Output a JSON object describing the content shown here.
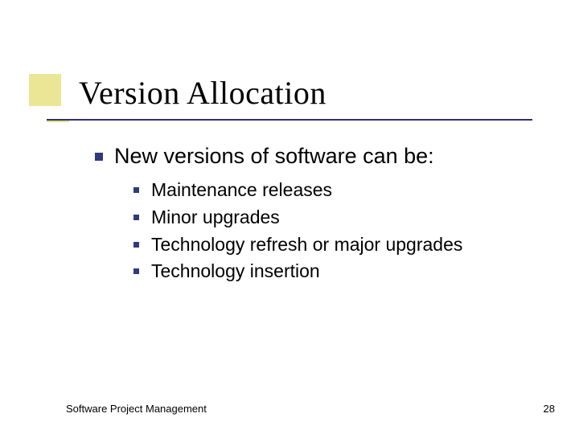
{
  "title": "Version Allocation",
  "main": {
    "heading": "New versions of software can be:",
    "items": [
      "Maintenance releases",
      "Minor upgrades",
      "Technology refresh or major upgrades",
      "Technology insertion"
    ]
  },
  "footer": {
    "left": "Software Project Management",
    "page": "28"
  }
}
